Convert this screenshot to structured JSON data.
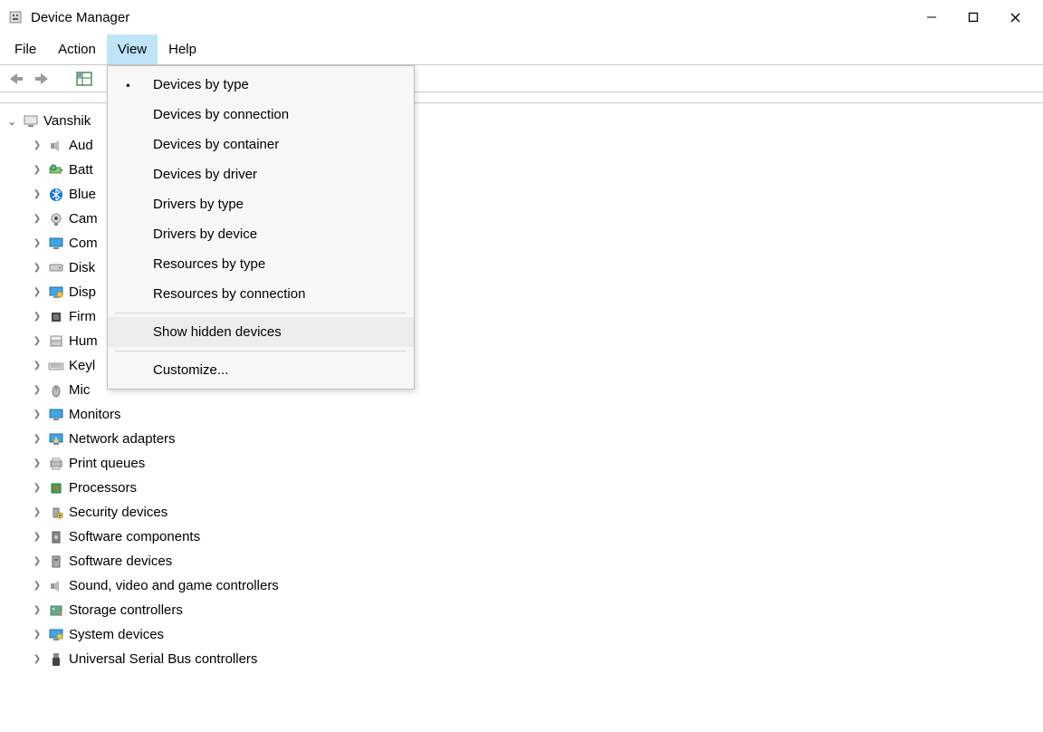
{
  "window": {
    "title": "Device Manager"
  },
  "menubar": {
    "file": "File",
    "action": "Action",
    "view": "View",
    "help": "Help"
  },
  "dropdown": {
    "devices_by_type": "Devices by type",
    "devices_by_connection": "Devices by connection",
    "devices_by_container": "Devices by container",
    "devices_by_driver": "Devices by driver",
    "drivers_by_type": "Drivers by type",
    "drivers_by_device": "Drivers by device",
    "resources_by_type": "Resources by type",
    "resources_by_connection": "Resources by connection",
    "show_hidden": "Show hidden devices",
    "customize": "Customize..."
  },
  "tree": {
    "root": "Vanshik",
    "items": [
      {
        "label": "Aud",
        "icon": "speaker"
      },
      {
        "label": "Batt",
        "icon": "battery"
      },
      {
        "label": "Blue",
        "icon": "bluetooth"
      },
      {
        "label": "Cam",
        "icon": "camera"
      },
      {
        "label": "Com",
        "icon": "monitor"
      },
      {
        "label": "Disk",
        "icon": "disk"
      },
      {
        "label": "Disp",
        "icon": "display"
      },
      {
        "label": "Firm",
        "icon": "chip"
      },
      {
        "label": "Hum",
        "icon": "hid"
      },
      {
        "label": "Keyl",
        "icon": "keyboard"
      },
      {
        "label": "Mic",
        "icon": "mouse"
      },
      {
        "label": "Monitors",
        "icon": "monitor"
      },
      {
        "label": "Network adapters",
        "icon": "network"
      },
      {
        "label": "Print queues",
        "icon": "printer"
      },
      {
        "label": "Processors",
        "icon": "cpu"
      },
      {
        "label": "Security devices",
        "icon": "security"
      },
      {
        "label": "Software components",
        "icon": "software"
      },
      {
        "label": "Software devices",
        "icon": "software2"
      },
      {
        "label": "Sound, video and game controllers",
        "icon": "speaker"
      },
      {
        "label": "Storage controllers",
        "icon": "storage"
      },
      {
        "label": "System devices",
        "icon": "system"
      },
      {
        "label": "Universal Serial Bus controllers",
        "icon": "usb"
      }
    ]
  }
}
